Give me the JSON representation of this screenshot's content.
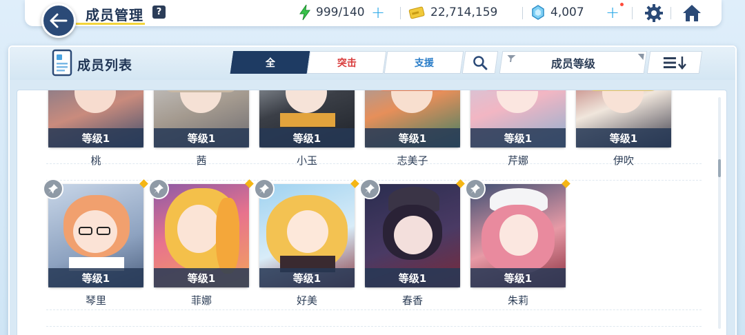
{
  "header": {
    "title": "成员管理",
    "help": "?",
    "stamina": "999/140",
    "credits": "22,714,159",
    "gems": "4,007"
  },
  "panel": {
    "title": "成员列表",
    "tabs": [
      {
        "label": "全",
        "active": true
      },
      {
        "label": "突击",
        "active": false
      },
      {
        "label": "支援",
        "active": false
      }
    ],
    "sort_label": "成员等级"
  },
  "colors": {
    "accent_dark": "#1e3b63",
    "assault": "#d83a3a",
    "support": "#2a7dc8",
    "gem": "#f5b614"
  },
  "members_row1": [
    {
      "name": "桃",
      "level": "等级1"
    },
    {
      "name": "茜",
      "level": "等级1"
    },
    {
      "name": "小玉",
      "level": "等级1"
    },
    {
      "name": "志美子",
      "level": "等级1"
    },
    {
      "name": "芹娜",
      "level": "等级1"
    },
    {
      "name": "伊吹",
      "level": "等级1"
    }
  ],
  "members_row2": [
    {
      "name": "琴里",
      "level": "等级1"
    },
    {
      "name": "菲娜",
      "level": "等级1"
    },
    {
      "name": "好美",
      "level": "等级1"
    },
    {
      "name": "春香",
      "level": "等级1"
    },
    {
      "name": "朱莉",
      "level": "等级1"
    }
  ]
}
